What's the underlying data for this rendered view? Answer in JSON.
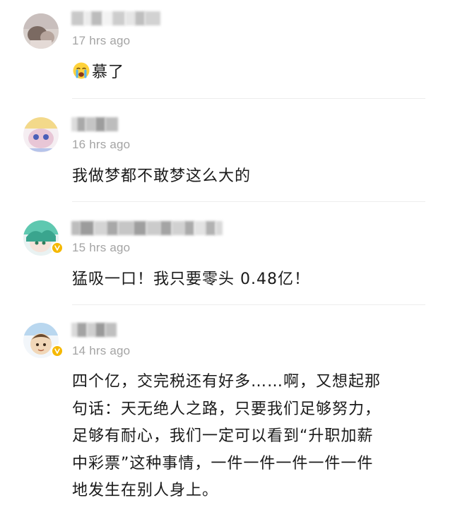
{
  "comments": [
    {
      "time": "17 hrs ago",
      "emoji": "loudly-crying-face-icon",
      "text": "慕了",
      "verified": false
    },
    {
      "time": "16 hrs ago",
      "text": "我做梦都不敢梦这么大的",
      "verified": false
    },
    {
      "time": "15 hrs ago",
      "text": "猛吸一口！我只要零头 0.48亿！",
      "verified": true
    },
    {
      "time": "14 hrs ago",
      "text_lines": [
        "四个亿，交完税还有好多……啊，又想起那",
        "句话：天无绝人之路，只要我们足够努力，",
        "足够有耐心，我们一定可以看到“升职加薪",
        "中彩票”这种事情，一件一件一件一件一件",
        "地发生在别人身上。"
      ],
      "verified": true
    }
  ],
  "colors": {
    "text": "#1a1a1a",
    "time": "#a4a4a4",
    "divider": "#ededed",
    "verified_badge": "#f5b800"
  }
}
